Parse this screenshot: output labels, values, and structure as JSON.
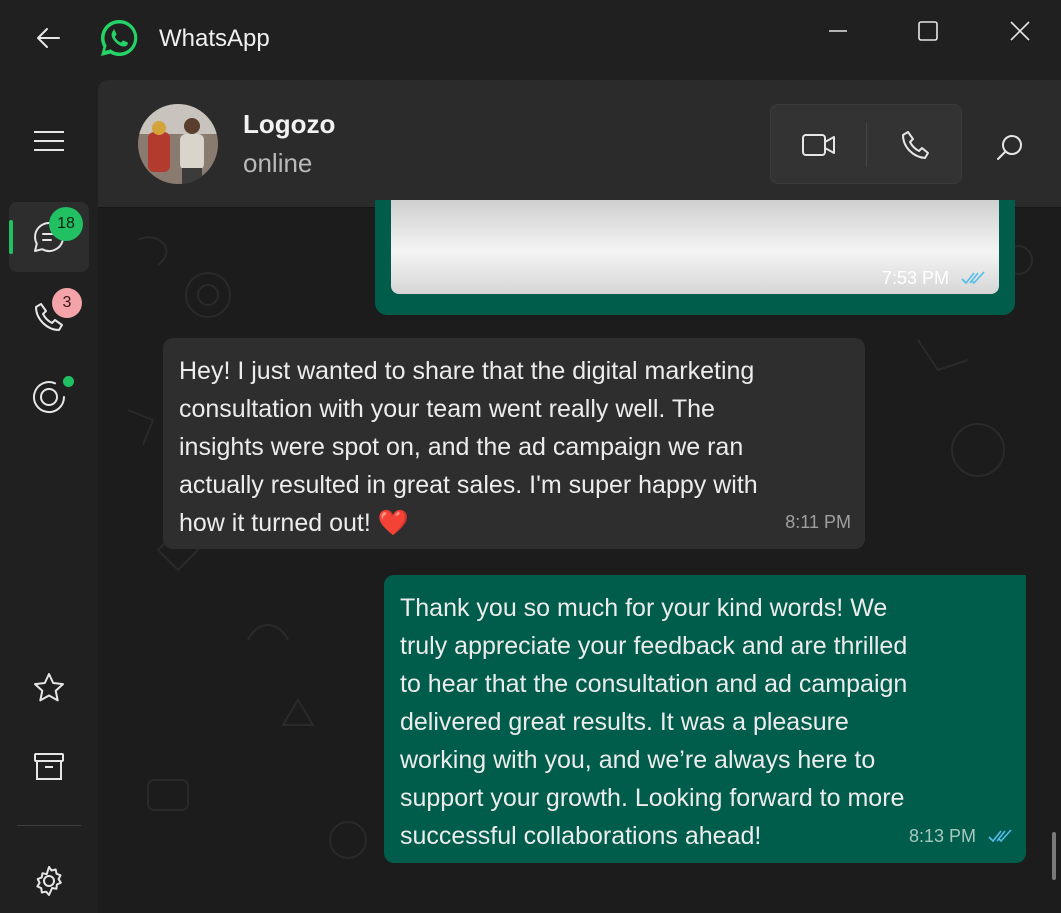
{
  "app": {
    "title": "WhatsApp"
  },
  "rail": {
    "chats_badge": "18",
    "calls_badge": "3"
  },
  "header": {
    "contact_name": "Logozo",
    "contact_status": "online"
  },
  "messages": [
    {
      "direction": "out",
      "type": "image",
      "time": "7:53 PM",
      "read": true
    },
    {
      "direction": "in",
      "text": "Hey! I just wanted to share that the digital marketing\nconsultation with your team went really well. The\ninsights were spot on, and the ad campaign we ran\nactually resulted in great sales. I'm super happy with\nhow it turned out! ❤️",
      "time": "8:11 PM"
    },
    {
      "direction": "out",
      "text": "Thank you so much for your kind words! We\ntruly appreciate your feedback and are thrilled\nto hear that the consultation and ad campaign\ndelivered great results. It was a pleasure\nworking with you, and we’re always here to\nsupport your growth. Looking forward to more\nsuccessful collaborations ahead!",
      "time": "8:13 PM",
      "read": true
    }
  ],
  "colors": {
    "brand_green": "#21c063",
    "outgoing_bubble": "#005c4b",
    "incoming_bubble": "#2e2e2e",
    "read_tick": "#53bdeb"
  },
  "icons": [
    "back-arrow-icon",
    "whatsapp-logo-icon",
    "minimize-icon",
    "maximize-icon",
    "close-icon",
    "menu-icon",
    "chats-icon",
    "calls-icon",
    "status-icon",
    "starred-icon",
    "archive-icon",
    "settings-icon",
    "video-call-icon",
    "voice-call-icon",
    "search-icon",
    "double-check-icon"
  ]
}
